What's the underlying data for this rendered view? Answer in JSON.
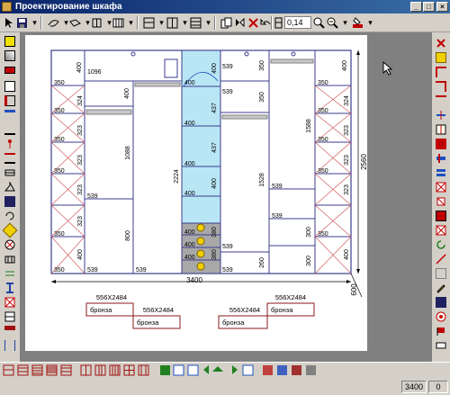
{
  "window": {
    "title": "Проектирование шкафа",
    "minimize_glyph": "_",
    "maximize_glyph": "□",
    "close_glyph": "×"
  },
  "toolbar": {
    "zoom_value": "0,14"
  },
  "drawing": {
    "total_width": "3400",
    "total_height": "2560",
    "depth": "600",
    "dimensions": {
      "top_left_shelf": "400",
      "top_left_width": "1096",
      "top_left_small": "400",
      "top_center_400": "400",
      "top_center_539": "539",
      "top_right_539": "539",
      "top_right_350": "350",
      "top_far_right_400": "400",
      "left_col_350_top": "350",
      "left_col_324": "324",
      "left_col_350_a": "350",
      "left_col_323_a": "323",
      "left_col_323_b": "323",
      "left_col_323_c": "323",
      "left_col_350_b": "350",
      "left_col_350_c": "350",
      "left_col_323_d": "323",
      "left_col_400_bottom": "400",
      "left_col_350_d": "350",
      "sec2_300": "300",
      "sec2_1088": "1088",
      "sec2_539_mid": "539",
      "sec2_800": "800",
      "sec2_539_bottom": "539",
      "sec3_2224": "2224",
      "sec3_539": "539",
      "drawers_400_a": "400",
      "drawers_437_a": "437",
      "drawers_437_b": "437",
      "drawers_400_b": "400",
      "drawers_380_a": "380",
      "drawers_380_b": "380",
      "drawers_400_c": "400",
      "drawers_400_d": "400",
      "drawers_400_e": "400",
      "drawers_400_f": "400",
      "drawers_400_g": "400",
      "sec5_350_top": "350",
      "sec5_539_a": "539",
      "sec5_350": "350",
      "sec5_1528": "1528",
      "sec5_539_mid": "539",
      "sec5_539_bottom": "539",
      "sec5_260": "260",
      "sec6_1588": "1588",
      "sec6_539_a": "539",
      "sec6_539_b": "539",
      "sec6_300_a": "300",
      "sec6_300_b": "300",
      "right_col_400_top": "400",
      "right_col_350_top": "350",
      "right_col_324": "324",
      "right_col_350_a": "350",
      "right_col_323_a": "323",
      "right_col_323_b": "323",
      "right_col_323_c": "323",
      "right_col_350_b": "350",
      "right_col_350_c": "350",
      "right_col_400_bottom": "400",
      "right_col_350_d": "350"
    },
    "doors": [
      {
        "size": "556X2484",
        "material": "бронза"
      },
      {
        "size": "556X2484",
        "material": "бронза"
      },
      {
        "size": "556X2484",
        "material": "бронза"
      },
      {
        "size": "556X2484",
        "material": "бронза"
      }
    ]
  },
  "status": {
    "width_value": "3400",
    "second_value": "0"
  },
  "colors": {
    "title_start": "#0a246a",
    "title_end": "#3a6ea5",
    "outline": "#3c3c8c",
    "drawer_fill": "#b9e6f5",
    "drawer_bottom_fill": "#9a9a9a",
    "knob": "#f0d000",
    "door_frame": "#8b1a1a",
    "diagonal": "#d06060",
    "rail": "#808080"
  }
}
